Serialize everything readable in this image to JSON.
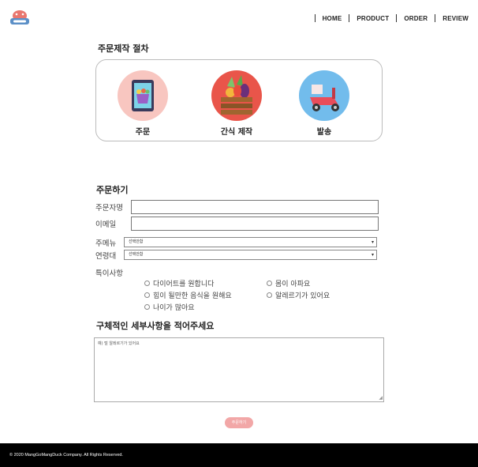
{
  "nav": {
    "items": [
      {
        "label": "HOME"
      },
      {
        "label": "PRODUCT"
      },
      {
        "label": "ORDER"
      },
      {
        "label": "REVIEW"
      }
    ]
  },
  "process": {
    "title": "주문제작 절차",
    "steps": [
      {
        "label": "주문",
        "icon": "tablet-basket-icon",
        "bg": "#f8c6c0"
      },
      {
        "label": "간식 제작",
        "icon": "vegetable-crate-icon",
        "bg": "#e9554a"
      },
      {
        "label": "발송",
        "icon": "scooter-icon",
        "bg": "#72bcec"
      }
    ]
  },
  "order": {
    "title": "주문하기",
    "name_label": "주문자명",
    "email_label": "이메일",
    "menu_label": "주메뉴",
    "menu_value": "선택안함",
    "age_label": "연령대",
    "age_value": "선택안함",
    "special_label": "특이사항",
    "options": [
      "다이어트를 원합니다",
      "몸이 아파요",
      "힘이 될만한 음식을 원해요",
      "알레르기가 있어요",
      "나이가 많아요"
    ],
    "detail_title": "구체적인 세부사항을 적어주세요",
    "detail_placeholder": "예) 털 알레르기가 있어요",
    "submit_label": "주문하기"
  },
  "footer": {
    "copyright": "© 2020 MangGoMangDuck Company. All Rights Reserved."
  },
  "colors": {
    "accent": "#f2a7a7",
    "footer_bg": "#000000"
  }
}
